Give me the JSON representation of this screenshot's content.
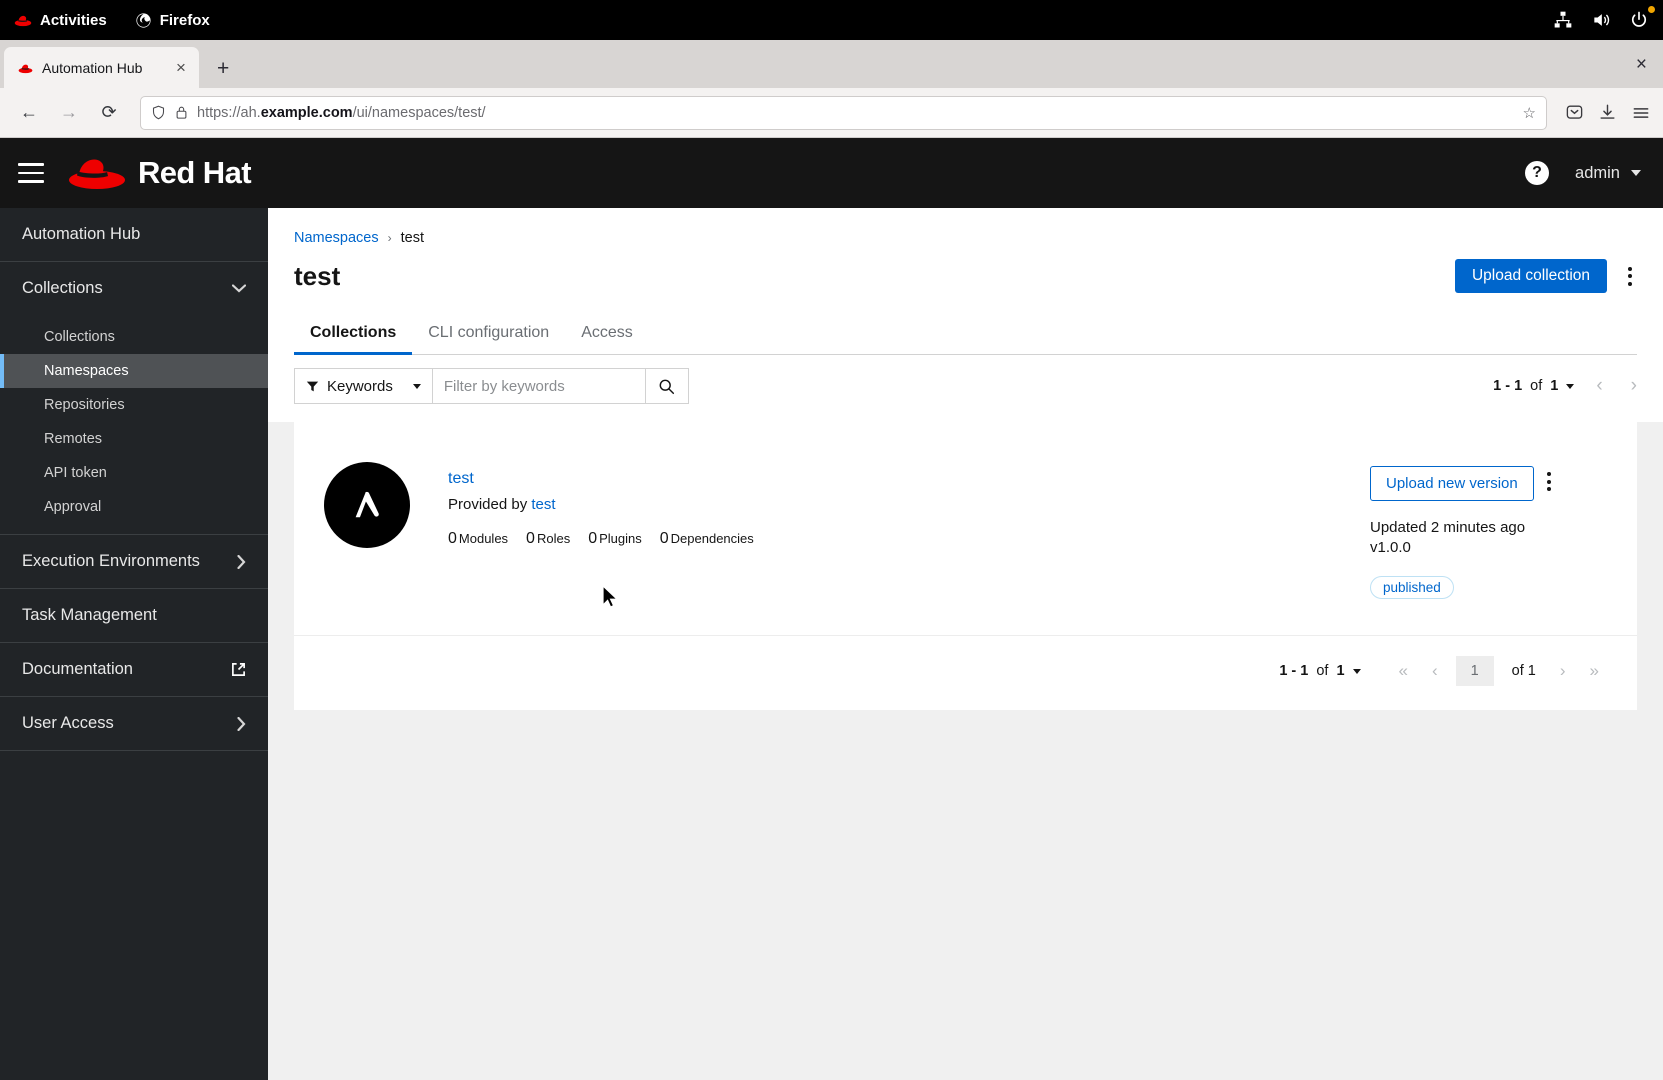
{
  "os_bar": {
    "activities": "Activities",
    "app_name": "Firefox",
    "tray": [
      "network-icon",
      "volume-icon",
      "power-icon"
    ]
  },
  "browser": {
    "tab_title": "Automation Hub",
    "new_tab_label": "+",
    "close_window_label": "×",
    "tab_close_label": "×",
    "back_label": "←",
    "forward_label": "→",
    "reload_label": "⟳",
    "url_scheme": "https://ah.",
    "url_domain": "example.com",
    "url_path": "/ui/namespaces/test/",
    "bookmark_label": "☆",
    "toolbar_icons": [
      "pocket-icon",
      "downloads-icon",
      "hamburger-menu-icon"
    ]
  },
  "masthead": {
    "brand": "Red Hat",
    "help_label": "?",
    "user": "admin"
  },
  "sidebar": {
    "app_title": "Automation Hub",
    "groups": [
      {
        "label": "Collections",
        "expanded": true,
        "state_icon": "chevron-down-icon"
      }
    ],
    "collections_children": [
      {
        "label": "Collections",
        "active": false
      },
      {
        "label": "Namespaces",
        "active": true
      },
      {
        "label": "Repositories",
        "active": false
      },
      {
        "label": "Remotes",
        "active": false
      },
      {
        "label": "API token",
        "active": false
      },
      {
        "label": "Approval",
        "active": false
      }
    ],
    "other": [
      {
        "label": "Execution Environments",
        "icon": "chevron-right-icon"
      },
      {
        "label": "Task Management",
        "icon": ""
      },
      {
        "label": "Documentation",
        "icon": "external-link-icon"
      },
      {
        "label": "User Access",
        "icon": "chevron-right-icon"
      }
    ]
  },
  "page": {
    "breadcrumb_root": "Namespaces",
    "breadcrumb_sep": "›",
    "breadcrumb_current": "test",
    "title": "test",
    "upload_collection_label": "Upload collection",
    "tabs": [
      {
        "label": "Collections",
        "active": true
      },
      {
        "label": "CLI configuration",
        "active": false
      },
      {
        "label": "Access",
        "active": false
      }
    ]
  },
  "toolbar": {
    "filter_label": "Keywords",
    "filter_placeholder": "Filter by keywords",
    "filter_value": "",
    "search_icon": "search-icon"
  },
  "pagination_top": {
    "range": "1 - 1",
    "of": "of",
    "total": "1",
    "prev": "‹",
    "next": "›"
  },
  "pagination_bottom": {
    "range": "1 - 1",
    "of": "of",
    "total": "1",
    "first": "«",
    "prev": "‹",
    "current_page": "1",
    "of_label": "of 1",
    "next": "›",
    "last": "»"
  },
  "collection": {
    "logo": "ansible-logo-icon",
    "name": "test",
    "provided_by_prefix": "Provided by",
    "provided_by": "test",
    "stats": [
      {
        "count": "0",
        "label": "Modules"
      },
      {
        "count": "0",
        "label": "Roles"
      },
      {
        "count": "0",
        "label": "Plugins"
      },
      {
        "count": "0",
        "label": "Dependencies"
      }
    ],
    "upload_new_version_label": "Upload new version",
    "updated": "Updated 2 minutes ago",
    "version": "v1.0.0",
    "status_badge": "published"
  },
  "colors": {
    "accent_blue": "#06c",
    "brand_red": "#ee0000",
    "sidebar_bg": "#212427",
    "masthead_bg": "#151515",
    "active_item_bg": "#4f5255",
    "active_item_bar": "#73bcf7"
  }
}
